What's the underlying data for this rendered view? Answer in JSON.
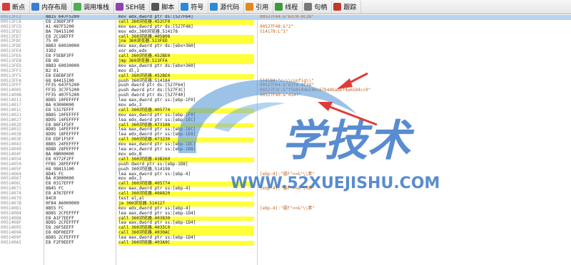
{
  "toolbar": {
    "items": [
      {
        "label": "断点",
        "icon": "breakpoint-icon",
        "color": "#d93b3b"
      },
      {
        "label": "内存布局",
        "icon": "memory-icon",
        "color": "#3a7bd5"
      },
      {
        "label": "调用堆栈",
        "icon": "callstack-icon",
        "color": "#4caf50"
      },
      {
        "label": "SEH链",
        "icon": "seh-icon",
        "color": "#8e44ad"
      },
      {
        "label": "脚本",
        "icon": "script-icon",
        "color": "#555555"
      },
      {
        "label": "符号",
        "icon": "symbol-icon",
        "color": "#2b8ad8"
      },
      {
        "label": "源代码",
        "icon": "source-icon",
        "color": "#2b8ad8"
      },
      {
        "label": "引用",
        "icon": "reference-icon",
        "color": "#e08a1e"
      },
      {
        "label": "线程",
        "icon": "thread-icon",
        "color": "#3a9b3a"
      },
      {
        "label": "句柄",
        "icon": "handle-icon",
        "color": "#777777"
      },
      {
        "label": "跟踪",
        "icon": "trace-icon",
        "color": "#c0392b"
      }
    ]
  },
  "watermark": {
    "logo_text": "学技术",
    "url_text": "WWW.52XUEJISHU.COM"
  },
  "disasm": [
    {
      "addr": "00513FC2",
      "hex": "8B15 647F5200",
      "asm": "mov edx,dword ptr ds:[527F64]",
      "cmt": "00527F64:&\"6370-8C38\"",
      "hl": "",
      "sel": true
    },
    {
      "addr": "00513FC8",
      "hex": "E8 236DF3FF",
      "asm": "call 360浏览器.452CF0",
      "cmt": "",
      "hl": "call"
    },
    {
      "addr": "00513FCD",
      "hex": "A1 487F5200",
      "asm": "mov eax,dword ptr ds:[527F48]",
      "cmt": "00527F48:&\"2\"",
      "hl": ""
    },
    {
      "addr": "00513FD2",
      "hex": "BA 78415100",
      "asm": "mov edx,360浏览器.514178",
      "cmt": "514178:L\"1\"",
      "hl": ""
    },
    {
      "addr": "00513FD7",
      "hex": "E8 2C18EFFF",
      "asm": "call 360浏览器.405808",
      "cmt": "",
      "hl": "call"
    },
    {
      "addr": "00513FDC",
      "hex": "75 0F",
      "asm": "jne 360浏览器.513FED",
      "cmt": "",
      "hl": "jmp"
    },
    {
      "addr": "00513FDE",
      "hex": "8B83 60030000",
      "asm": "mov eax,dword ptr ds:[ebx+360]",
      "cmt": "",
      "hl": ""
    },
    {
      "addr": "00513FE4",
      "hex": "33D2",
      "asm": "xor edx,edx",
      "cmt": "",
      "hl": ""
    },
    {
      "addr": "00513FE6",
      "hex": "E8 F5EBF3FF",
      "asm": "call 360浏览器.452BE0",
      "cmt": "",
      "hl": "call"
    },
    {
      "addr": "00513FEB",
      "hex": "EB 0D",
      "asm": "jmp 360浏览器.513FFA",
      "cmt": "",
      "hl": "jmp"
    },
    {
      "addr": "00513FED",
      "hex": "8B83 60030000",
      "asm": "mov eax,dword ptr ds:[ebx+360]",
      "cmt": "",
      "hl": ""
    },
    {
      "addr": "00513FF3",
      "hex": "B2 01",
      "asm": "mov dl,1",
      "cmt": "",
      "hl": ""
    },
    {
      "addr": "00513FF5",
      "hex": "E8 E6EBF3FF",
      "asm": "call 360浏览器.452BE0",
      "cmt": "",
      "hl": "call"
    },
    {
      "addr": "00513FFA",
      "hex": "68 84415100",
      "asm": "push 360浏览器.514184",
      "cmt": "514184:\"c:\\\\config\\\\\"",
      "hl": ""
    },
    {
      "addr": "00513FFF",
      "hex": "FF35 647F5200",
      "asm": "push dword ptr ds:[527F64]",
      "cmt": "00527F64:&\"6370-8C38\"",
      "hl": ""
    },
    {
      "addr": "00514005",
      "hex": "FF35 3C7F5200",
      "asm": "push dword ptr ds:[527F3C]",
      "cmt": "00527F3C:&\"f5b0c0de146c67b44babbf4e6584cc0\"",
      "hl": ""
    },
    {
      "addr": "0051400B",
      "hex": "FF35 407F5200",
      "asm": "push dword ptr ds:[527F40]",
      "cmt": "00527F40:&\"4147\"",
      "hl": ""
    },
    {
      "addr": "00514011",
      "hex": "8D85 10FEFFFF",
      "asm": "lea eax,dword ptr ss:[ebp-1F0]",
      "cmt": "",
      "hl": ""
    },
    {
      "addr": "00514017",
      "hex": "BA 03000000",
      "asm": "mov edx,3",
      "cmt": "",
      "hl": ""
    },
    {
      "addr": "0051401C",
      "hex": "E8 5317EFFF",
      "asm": "call 360浏览器.405774",
      "cmt": "",
      "hl": "call"
    },
    {
      "addr": "00514021",
      "hex": "8B85 10FEFFFF",
      "asm": "mov eax,dword ptr ss:[ebp-1F0]",
      "cmt": "",
      "hl": ""
    },
    {
      "addr": "00514027",
      "hex": "8D95 14FEFFFF",
      "asm": "lea edx,dword ptr ss:[ebp-1EC]",
      "cmt": "",
      "hl": ""
    },
    {
      "addr": "0051402D",
      "hex": "E8 86F1F5FF",
      "asm": "call 360浏览器.473188",
      "cmt": "",
      "hl": "call"
    },
    {
      "addr": "00514032",
      "hex": "8D85 14FEFFFF",
      "asm": "lea eax,dword ptr ss:[ebp-1EC]",
      "cmt": "",
      "hl": ""
    },
    {
      "addr": "00514038",
      "hex": "8D95 18FEFFFF",
      "asm": "lea edx,dword ptr ss:[ebp-1E8]",
      "cmt": "",
      "hl": ""
    },
    {
      "addr": "0051403E",
      "hex": "E8 EDF1F5FF",
      "asm": "call 360浏览器.473230",
      "cmt": "",
      "hl": "call"
    },
    {
      "addr": "00514043",
      "hex": "8B85 24FEFFFF",
      "asm": "mov eax,dword ptr ss:[ebp-1DC]",
      "cmt": "",
      "hl": ""
    },
    {
      "addr": "00514049",
      "hex": "8D8D 28FEFFFF",
      "asm": "lea ecx,dword ptr ss:[ebp-1D8]",
      "cmt": "",
      "hl": ""
    },
    {
      "addr": "0051404F",
      "hex": "BA 0B000000",
      "asm": "mov edx,B",
      "cmt": "",
      "hl": ""
    },
    {
      "addr": "00514054",
      "hex": "E8 0772F2FF",
      "asm": "call 360浏览器.43B260",
      "cmt": "",
      "hl": "call"
    },
    {
      "addr": "00514059",
      "hex": "FFB5 28FEFFFF",
      "asm": "push dword ptr ss:[ebp-1D8]",
      "cmt": "",
      "hl": ""
    },
    {
      "addr": "0051405F",
      "hex": "68 98415100",
      "asm": "push 360浏览器.514198",
      "cmt": "",
      "hl": ""
    },
    {
      "addr": "00514064",
      "hex": "8D45 FC",
      "asm": "lea eax,dword ptr ss:[ebp-4]",
      "cmt": "[ebp-4]:\"疆F\"==&\"\\\\素\"",
      "hl": ""
    },
    {
      "addr": "00514067",
      "hex": "BA 03000000",
      "asm": "mov edx,3",
      "cmt": "",
      "hl": ""
    },
    {
      "addr": "0051406C",
      "hex": "E8 0317EFFF",
      "asm": "call 360浏览器.405774",
      "cmt": "",
      "hl": "call"
    },
    {
      "addr": "00514071",
      "hex": "8B45 FC",
      "asm": "mov eax,dword ptr ss:[ebp-4]",
      "cmt": "[ebp-4]:\"疆F\"==&\"\\\\素\"",
      "hl": ""
    },
    {
      "addr": "00514074",
      "hex": "E8 A767EFFF",
      "asm": "call 360浏览器.40A820",
      "cmt": "",
      "hl": "call"
    },
    {
      "addr": "00514079",
      "hex": "84C0",
      "asm": "test al,al",
      "cmt": "",
      "hl": ""
    },
    {
      "addr": "0051407B",
      "hex": "0F84 A6000000",
      "asm": "je 360浏览器.514127",
      "cmt": "",
      "hl": "jmp"
    },
    {
      "addr": "00514081",
      "hex": "8B55 FC",
      "asm": "mov edx,dword ptr ss:[ebp-4]",
      "cmt": "[ebp-4]:\"疆F\"==&\"\\\\素\"",
      "hl": ""
    },
    {
      "addr": "00514084",
      "hex": "8D85 2CFEFFFF",
      "asm": "lea eax,dword ptr ss:[ebp-1D4]",
      "cmt": "",
      "hl": ""
    },
    {
      "addr": "0051408A",
      "hex": "E8 A1F7EEFF",
      "asm": "call 360浏览器.403830",
      "cmt": "",
      "hl": "call"
    },
    {
      "addr": "0051408F",
      "hex": "8D85 2CFEFFFF",
      "asm": "lea eax,dword ptr ss:[ebp-1D4]",
      "cmt": "",
      "hl": ""
    },
    {
      "addr": "00514095",
      "hex": "E8 26F5EEFF",
      "asm": "call 360浏览器.4035C0",
      "cmt": "",
      "hl": "call"
    },
    {
      "addr": "0051409A",
      "hex": "E8 0DF0EEFF",
      "asm": "call 360浏览器.4030AC",
      "cmt": "",
      "hl": "call"
    },
    {
      "addr": "0051409F",
      "hex": "8D85 2CFEFFFF",
      "asm": "lea eax,dword ptr ss:[ebp-1D4]",
      "cmt": "",
      "hl": ""
    },
    {
      "addr": "005140A5",
      "hex": "E8 F2F9EEFF",
      "asm": "call 360浏览器.403A9C",
      "cmt": "",
      "hl": "call"
    }
  ]
}
